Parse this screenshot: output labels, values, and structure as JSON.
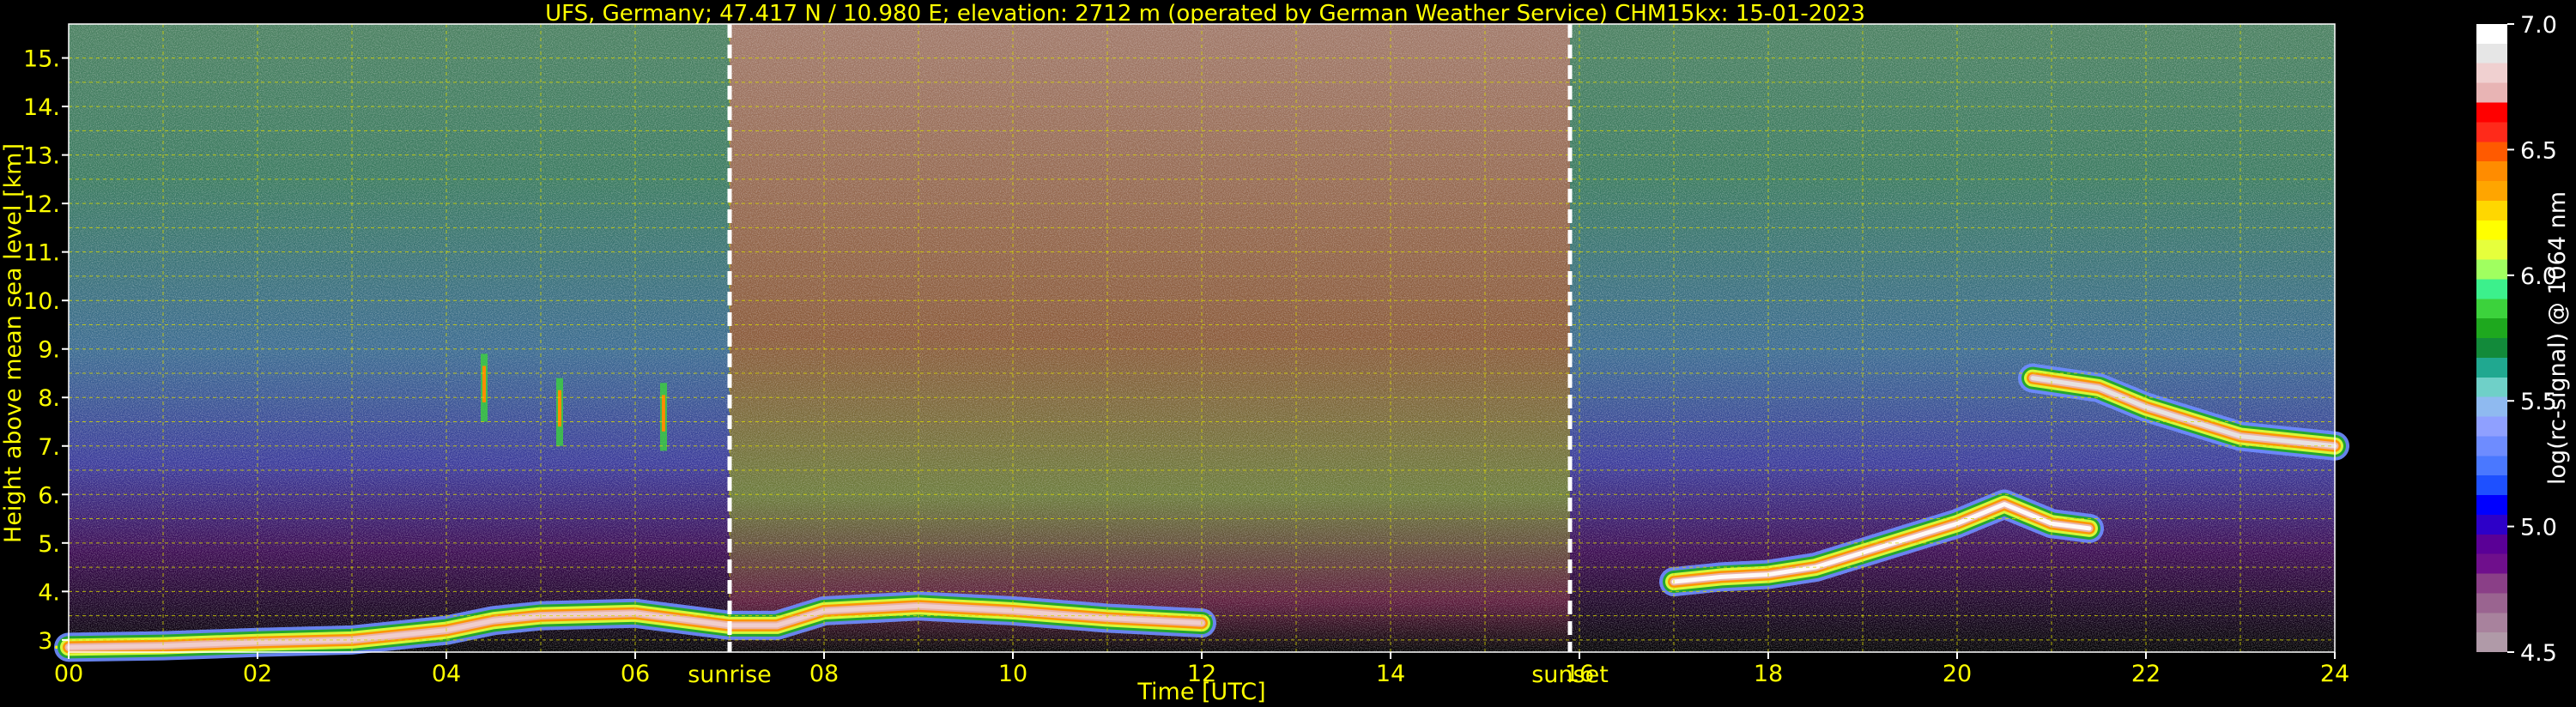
{
  "chart_data": {
    "type": "heatmap",
    "title": "UFS, Germany; 47.417 N / 10.980 E; elevation: 2712 m  (operated by German Weather Service)    CHM15kx: 15-01-2023",
    "xlabel": "Time [UTC]",
    "ylabel": "Height above mean sea level [km]",
    "xlim": [
      0,
      24
    ],
    "ylim": [
      2.75,
      15.7
    ],
    "x_ticks": [
      "00",
      "02",
      "04",
      "06",
      "08",
      "10",
      "12",
      "14",
      "16",
      "18",
      "20",
      "22",
      "24"
    ],
    "y_ticks": [
      "3.",
      "4.",
      "5.",
      "6.",
      "7.",
      "8.",
      "9.",
      "10.",
      "11.",
      "12.",
      "13.",
      "14.",
      "15."
    ],
    "grid": true,
    "markers": [
      {
        "label": "sunrise",
        "x": 7.0
      },
      {
        "label": "sunset",
        "x": 15.9
      }
    ],
    "colorbar": {
      "label": "log(rc-signal) @ 1064 nm",
      "range": [
        4.5,
        7.0
      ],
      "ticks": [
        "4.5",
        "5.0",
        "5.5",
        "6.0",
        "6.5",
        "7.0"
      ],
      "colors": [
        "#b09aa8",
        "#a8829d",
        "#9a6490",
        "#8a3f87",
        "#6f0f8c",
        "#5a0096",
        "#2d00c8",
        "#0000ff",
        "#1e50ff",
        "#4a78ff",
        "#6e8cff",
        "#8fa0ff",
        "#8fbaf0",
        "#6fd0c8",
        "#20a890",
        "#128a3a",
        "#1ea81e",
        "#3cd23c",
        "#3cf08c",
        "#a0ff60",
        "#e6ff3c",
        "#ffff00",
        "#ffd700",
        "#ffa500",
        "#ff8c00",
        "#ff5a00",
        "#ff2a1a",
        "#ff0000",
        "#e8b4b4",
        "#f0d0d0",
        "#e6e6e6",
        "#ffffff"
      ]
    },
    "features": [
      {
        "name": "boundary layer",
        "x": [
          0,
          1,
          2,
          3,
          4,
          4.5,
          5,
          6,
          7,
          7.5,
          8,
          9,
          10,
          11,
          12
        ],
        "y": [
          2.85,
          2.88,
          2.95,
          3.0,
          3.2,
          3.4,
          3.5,
          3.55,
          3.3,
          3.3,
          3.6,
          3.7,
          3.6,
          3.45,
          3.35
        ],
        "intensity": 6.8
      },
      {
        "name": "mid-level cloud",
        "x": [
          17.0,
          17.5,
          18,
          18.5,
          19,
          19.5,
          20,
          20.5,
          21,
          21.4
        ],
        "y": [
          4.2,
          4.3,
          4.35,
          4.5,
          4.8,
          5.1,
          5.4,
          5.8,
          5.4,
          5.3
        ],
        "intensity": 7.0
      },
      {
        "name": "upper cloud",
        "x": [
          20.8,
          21.5,
          22,
          22.5,
          23,
          23.5,
          24
        ],
        "y": [
          8.4,
          8.2,
          7.8,
          7.5,
          7.2,
          7.1,
          7.0
        ],
        "intensity": 6.9
      },
      {
        "name": "virga streaks",
        "x": [
          4.4,
          5.2,
          6.3
        ],
        "y": [
          8.2,
          7.7,
          7.6
        ],
        "intensity": 6.4
      }
    ]
  }
}
